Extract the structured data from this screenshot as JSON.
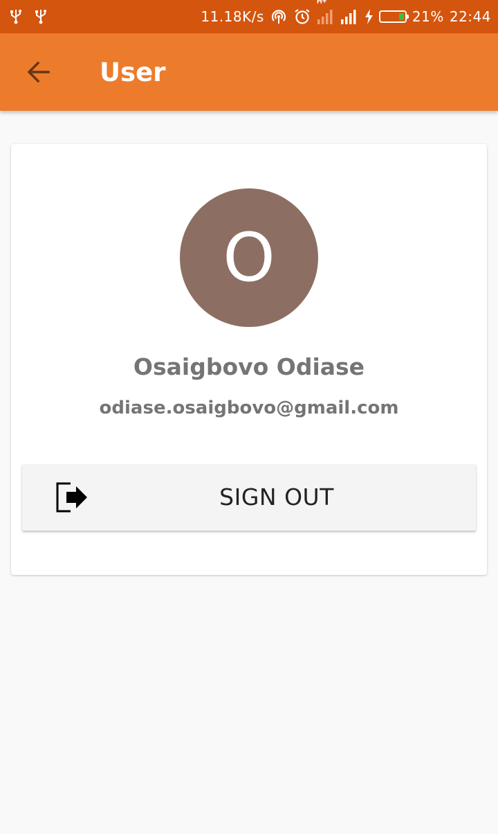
{
  "status_bar": {
    "network_speed": "11.18K/s",
    "network_type": "H+",
    "battery": "21%",
    "time": "22:44",
    "icons": [
      "usb-icon",
      "usb-icon",
      "hotspot-icon",
      "alarm-icon",
      "signal-icon",
      "signal-icon",
      "charging-icon",
      "battery-icon"
    ]
  },
  "app_bar": {
    "title": "User",
    "back_icon": "arrow-back-icon"
  },
  "profile": {
    "avatar_initial": "O",
    "avatar_color": "#8d6e63",
    "name": "Osaigbovo Odiase",
    "email": "odiase.osaigbovo@gmail.com"
  },
  "actions": {
    "sign_out_label": "SIGN OUT",
    "sign_out_icon": "sign-out-icon"
  },
  "colors": {
    "status_bar": "#d4550e",
    "app_bar": "#ec7c2c",
    "background": "#f9f9f9"
  }
}
